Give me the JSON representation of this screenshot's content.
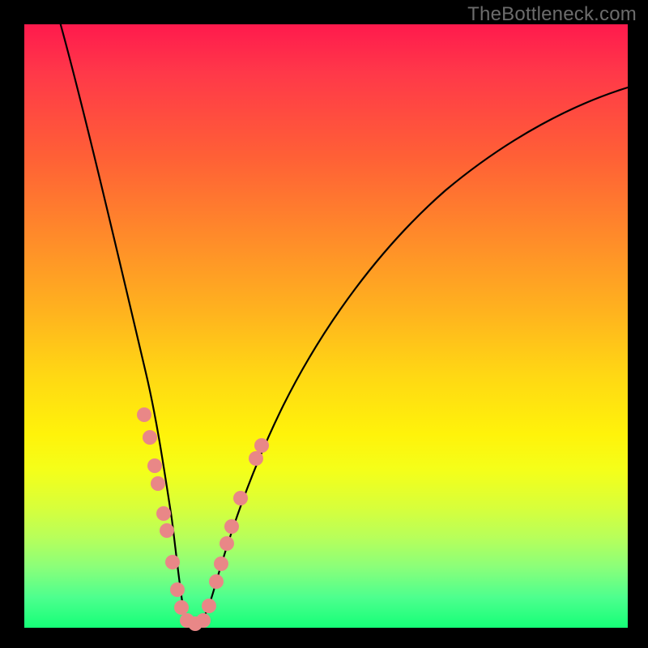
{
  "watermark": "TheBottleneck.com",
  "colors": {
    "frame": "#000000",
    "curve": "#000000",
    "marker": "#e98787",
    "gradient_top": "#ff1a4d",
    "gradient_bottom": "#15ff77"
  },
  "chart_data": {
    "type": "line",
    "title": "",
    "xlabel": "",
    "ylabel": "",
    "xlim": [
      0,
      100
    ],
    "ylim": [
      0,
      100
    ],
    "x": [
      0,
      4,
      8,
      12,
      16,
      18,
      20,
      22,
      23,
      24,
      25,
      26,
      27,
      28,
      30,
      32,
      35,
      40,
      45,
      50,
      55,
      60,
      65,
      70,
      75,
      80,
      85,
      90,
      95,
      100
    ],
    "y": [
      100,
      87,
      74,
      61,
      47,
      39,
      30,
      20,
      14,
      8,
      3,
      1,
      1,
      3,
      10,
      18,
      28,
      41,
      50,
      58,
      64,
      69,
      73,
      76,
      79,
      81,
      83,
      84.5,
      86,
      87
    ],
    "series": [
      {
        "name": "bottleneck-curve",
        "note": "single V-shaped curve; y is mismatch % vs hardware balance. minimum ~25 on x-axis"
      }
    ],
    "markers": {
      "note": "pink dot markers clustered near the V bottom along the curve",
      "x": [
        18.5,
        19.6,
        20.7,
        21.5,
        22.2,
        23.2,
        23.9,
        24.6,
        25.2,
        25.9,
        26.5,
        27.1,
        28.1,
        29.0,
        30.2,
        31.1,
        32.6,
        33.7
      ],
      "y": [
        36,
        32,
        27,
        22,
        17,
        11,
        7,
        4,
        2,
        1,
        1.5,
        3,
        6,
        10,
        15,
        20,
        27,
        31
      ]
    }
  }
}
